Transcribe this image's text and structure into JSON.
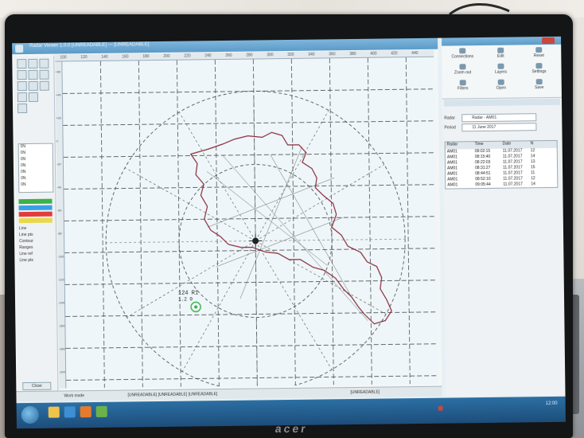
{
  "window": {
    "title": "Radar Viewer 1.0.0 [UNREADABLE] — [UNREADABLE]"
  },
  "ruler": {
    "top_ticks": [
      "100",
      "120",
      "140",
      "160",
      "180",
      "200",
      "220",
      "240",
      "260",
      "280",
      "300",
      "320",
      "340",
      "360",
      "380",
      "400",
      "420",
      "440"
    ],
    "left_ticks": [
      "+60",
      "+40",
      "+20",
      "0",
      "-20",
      "-40",
      "-60",
      "-80",
      "-100",
      "-120",
      "-140",
      "-160",
      "-180",
      "-200"
    ]
  },
  "tool_panel": {
    "list_items": [
      "0N",
      "0N",
      "0N",
      "0N",
      "0N",
      "0N",
      "0N"
    ],
    "legend_colors": [
      "#3bb24a",
      "#3aa0e6",
      "#e33b3b",
      "#e8d84b"
    ],
    "checkbox_labels": [
      "Line",
      "Line pts",
      "Contour",
      "Ranges",
      "Line ref",
      "Line pts"
    ],
    "btn_bottom": "Close"
  },
  "map": {
    "target_label": "124  R1",
    "target_sub": "1.2  0"
  },
  "status": {
    "left": "Work mode",
    "mid": "[UNREADABLE]  [UNREADABLE]  [UNREADABLE]",
    "right": "[UNREADABLE]"
  },
  "right_panel": {
    "ribbon": [
      {
        "label": "Connections",
        "icon": "network-icon"
      },
      {
        "label": "Edit",
        "icon": "pencil-icon"
      },
      {
        "label": "Reset",
        "icon": "refresh-icon"
      },
      {
        "label": "Zoom out",
        "icon": "zoom-out-icon"
      },
      {
        "label": "Layers",
        "icon": "layers-icon"
      },
      {
        "label": "Settings",
        "icon": "gear-icon"
      },
      {
        "label": "Filters",
        "icon": "filter-icon"
      },
      {
        "label": "Open",
        "icon": "folder-icon"
      },
      {
        "label": "Save",
        "icon": "save-icon"
      }
    ],
    "filter": {
      "label1": "Radar",
      "value1": "Radar - AM01",
      "label2": "Period",
      "value2": "11 June 2017"
    },
    "table": {
      "headers": [
        "Radar",
        "Time",
        "Date",
        "N"
      ],
      "rows": [
        [
          "AM01",
          "08:02:15",
          "11.07.2017",
          "12"
        ],
        [
          "AM01",
          "08:15:40",
          "11.07.2017",
          "14"
        ],
        [
          "AM01",
          "08:22:03",
          "11.07.2017",
          "13"
        ],
        [
          "AM01",
          "08:31:27",
          "11.07.2017",
          "15"
        ],
        [
          "AM01",
          "08:44:51",
          "11.07.2017",
          "11"
        ],
        [
          "AM01",
          "08:52:10",
          "11.07.2017",
          "12"
        ],
        [
          "AM01",
          "09:05:44",
          "11.07.2017",
          "14"
        ]
      ]
    }
  },
  "taskbar": {
    "clock": "12:00"
  },
  "monitor": {
    "brand": "acer"
  },
  "colors": {
    "titlebar": "#5b9bc8",
    "border_contour": "#8b2a3a",
    "grid": "#333333"
  }
}
